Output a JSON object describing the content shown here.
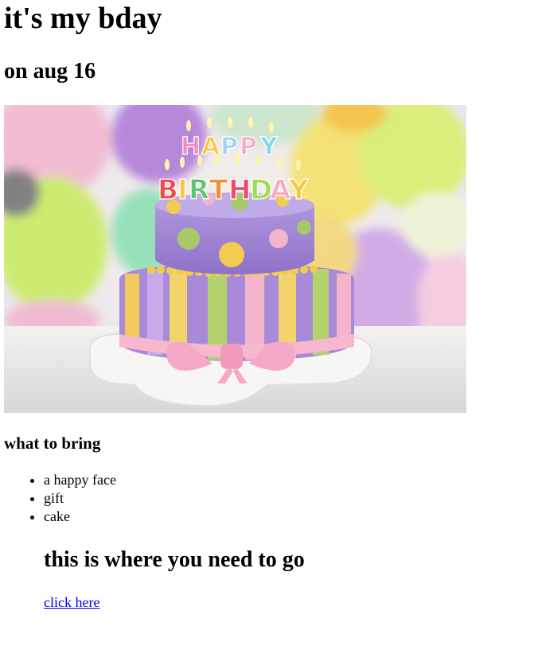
{
  "heading": "it's my bday",
  "date_heading": "on aug 16",
  "image": {
    "description_icon": "birthday-cake-photo",
    "cake_lettering": "HAPPY BIRTHDAY"
  },
  "bring_heading": "what to bring",
  "items": [
    "a happy face",
    "gift",
    "cake"
  ],
  "location_heading": "this is where you need to go",
  "link_text": "click here",
  "colors": {
    "link": "#0000ee",
    "text": "#000000"
  }
}
